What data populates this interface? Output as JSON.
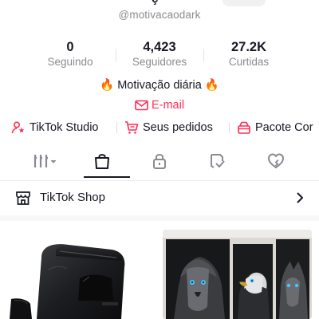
{
  "profile": {
    "handle": "@motivacaodark"
  },
  "stats": [
    {
      "value": "0",
      "label": "Seguindo"
    },
    {
      "value": "4,423",
      "label": "Seguidores"
    },
    {
      "value": "27.2K",
      "label": "Curtidas"
    }
  ],
  "bio": {
    "text": "Motivação diária",
    "emoji": "🔥"
  },
  "email": {
    "label": "E-mail"
  },
  "links": [
    {
      "label": "TikTok Studio",
      "icon": "person-star-icon"
    },
    {
      "label": "Seus pedidos",
      "icon": "cart-icon"
    },
    {
      "label": "Pacote Cor",
      "icon": "package-icon"
    }
  ],
  "tabs": [
    {
      "name": "videos-grid",
      "icon": "grid-icon"
    },
    {
      "name": "shop",
      "icon": "shopping-bag-icon",
      "selected": true
    },
    {
      "name": "private",
      "icon": "lock-icon"
    },
    {
      "name": "reposts",
      "icon": "repost-icon"
    },
    {
      "name": "liked",
      "icon": "heart-icon"
    }
  ],
  "shop": {
    "label": "TikTok Shop"
  },
  "colors": {
    "accent": "#fe2c55",
    "text": "#161823",
    "muted": "#8a8b91"
  }
}
